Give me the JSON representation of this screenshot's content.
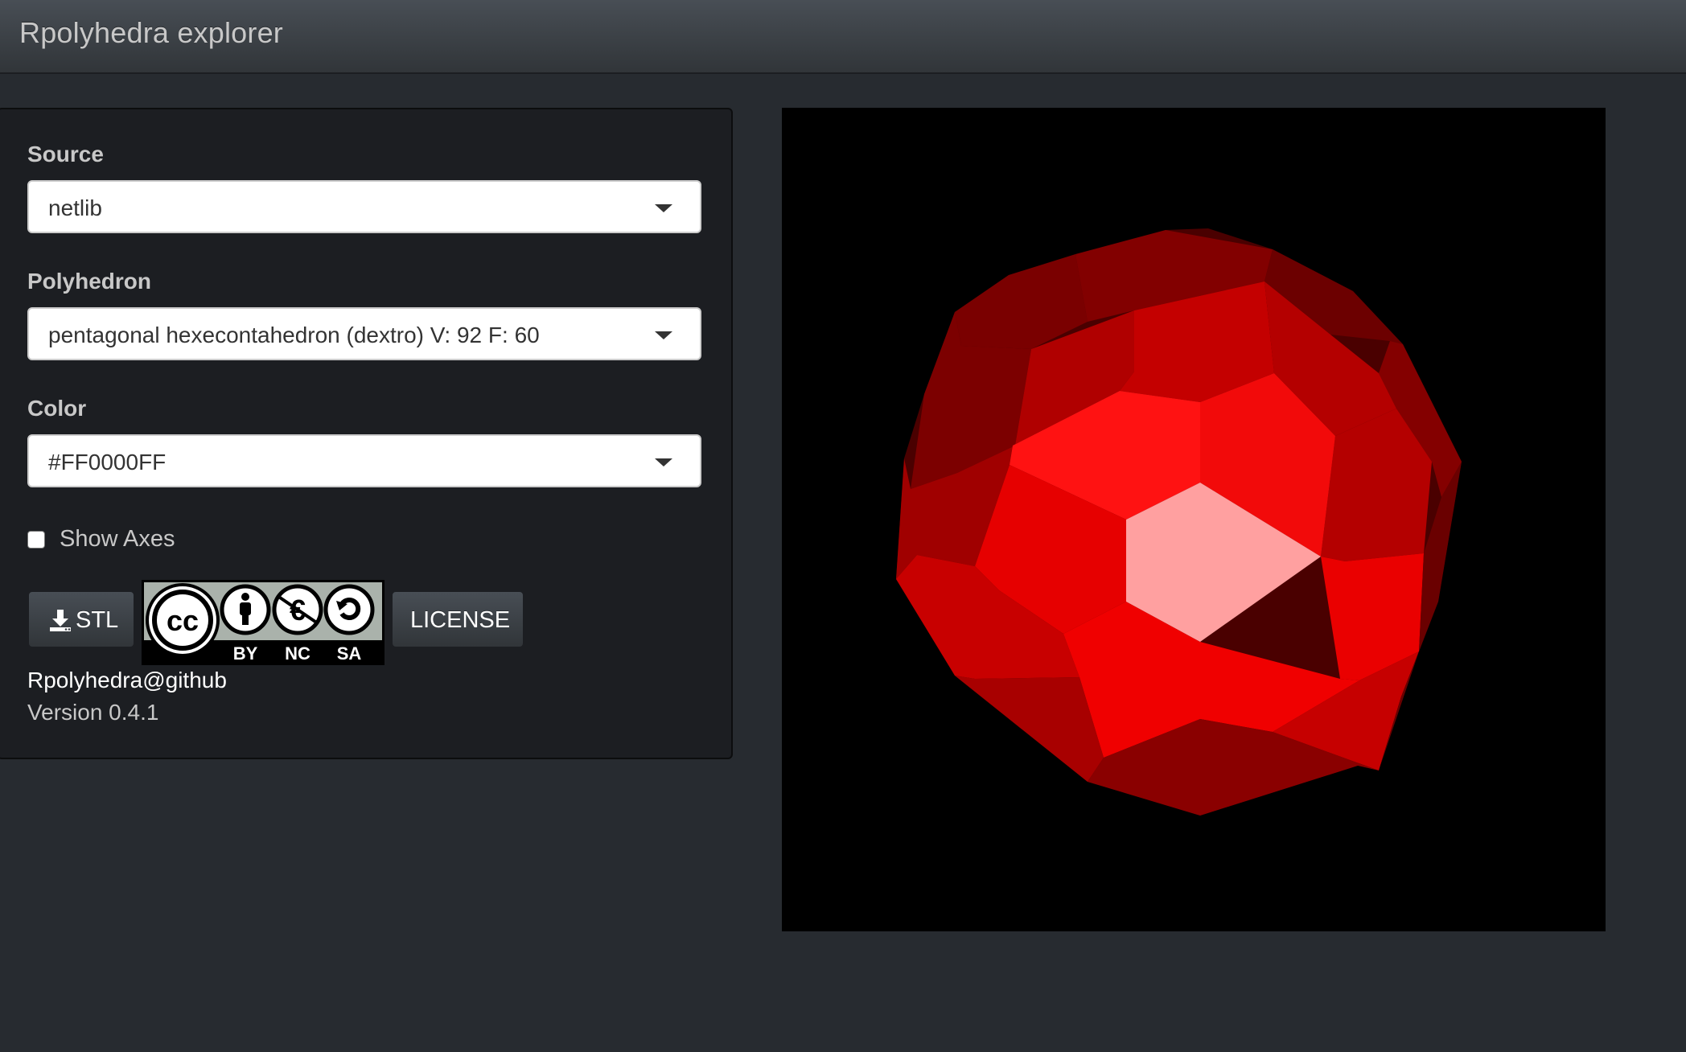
{
  "app": {
    "title": "Rpolyhedra explorer"
  },
  "sidebar": {
    "source": {
      "label": "Source",
      "value": "netlib"
    },
    "polyhedron": {
      "label": "Polyhedron",
      "value": "pentagonal hexecontahedron (dextro) V: 92 F: 60"
    },
    "color": {
      "label": "Color",
      "value": "#FF0000FF"
    },
    "show_axes": {
      "label": "Show Axes",
      "checked": false
    },
    "buttons": {
      "stl_label": "STL",
      "license_label": "LICENSE"
    },
    "license_badge": {
      "text": "BY NC SA",
      "icons": [
        "cc-icon",
        "by-icon",
        "nc-icon",
        "sa-icon"
      ]
    },
    "footer": {
      "link_text": "Rpolyhedra@github",
      "version_text": "Version 0.4.1"
    }
  },
  "viewer": {
    "object": "pentagonal hexecontahedron",
    "base_color": "#FF0000"
  },
  "colors": {
    "background": "#272b30",
    "panel": "#1c1e22",
    "navbar": "#3a3f44",
    "viewer_bg": "#000000"
  }
}
